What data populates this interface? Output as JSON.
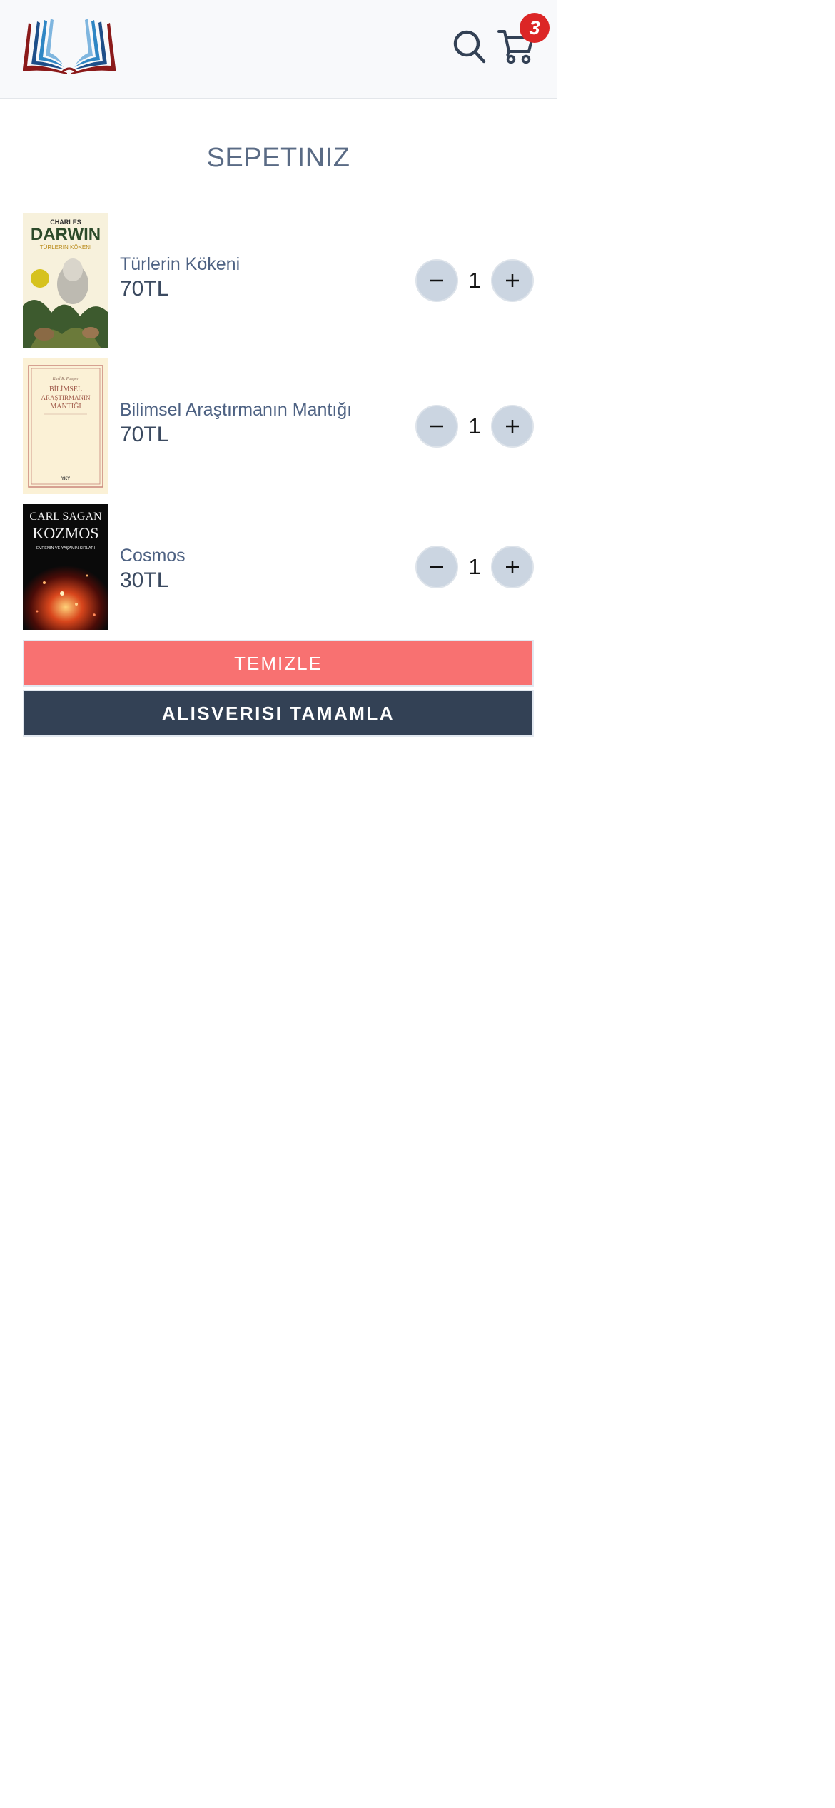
{
  "header": {
    "logo": "open-book-logo",
    "search_icon": "search-icon",
    "cart_icon": "cart-icon",
    "cart_count": "3"
  },
  "page_title": "SEPETINIZ",
  "cart": {
    "items": [
      {
        "name": "Türlerin Kökeni",
        "price": "70TL",
        "quantity": "1",
        "cover": {
          "author": "CHARLES",
          "title": "DARWIN",
          "subtitle": "TÜRLERIN KÖKENI"
        }
      },
      {
        "name": "Bilimsel Araştırmanın Mantığı",
        "price": "70TL",
        "quantity": "1",
        "cover": {
          "author": "Karl R. Popper",
          "title_line1": "BİLİMSEL",
          "title_line2": "ARAŞTIRMANIN",
          "title_line3": "MANTIĞI",
          "publisher": "YKY"
        }
      },
      {
        "name": "Cosmos",
        "price": "30TL",
        "quantity": "1",
        "cover": {
          "author": "CARL SAGAN",
          "title": "KOZMOS",
          "subtitle": "EVRENİN VE YAŞAMIN SIRLARI"
        }
      }
    ]
  },
  "buttons": {
    "clear": "TEMIZLE",
    "checkout": "ALISVERISI TAMAMLA"
  },
  "colors": {
    "clear_button": "#f87171",
    "checkout_button": "#334155",
    "badge": "#dc2626",
    "qty_button": "#cbd5e1"
  }
}
